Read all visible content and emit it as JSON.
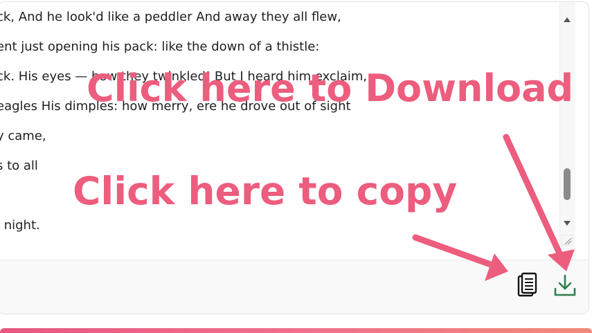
{
  "poem_lines": [
    "ck, And he look'd like a peddler And away they all flew,",
    "ent just opening his pack: like the down of a thistle:",
    "ck. His eyes — how they twinkled! But I heard him exclaim,",
    "eagles His dimples: how merry, ere he drove out of sight",
    "y came,",
    "s to all",
    "",
    "l night."
  ],
  "annotations": {
    "download": "Click here to Download",
    "copy": "Click here to copy"
  },
  "icons": {
    "copy": "copy-document-icon",
    "download": "download-icon"
  },
  "colors": {
    "annotation": "#ec5d7e",
    "download_icon": "#2e7d4f"
  }
}
